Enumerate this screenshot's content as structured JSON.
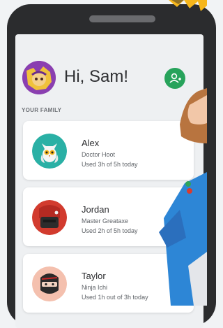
{
  "header": {
    "greeting": "Hi, Sam!"
  },
  "family": {
    "title": "YOUR FAMILY",
    "members": [
      {
        "name": "Alex",
        "device": "Doctor Hoot",
        "usage": "Used 3h of 5h today",
        "avatar_color": "#2ab0a5"
      },
      {
        "name": "Jordan",
        "device": "Master Greataxe",
        "usage": "Used 2h of 5h today",
        "avatar_color": "#d23b2e"
      },
      {
        "name": "Taylor",
        "device": "Ninja Ichi",
        "usage": "Used 1h out of 3h today",
        "avatar_color": "#f2b6a6"
      }
    ]
  },
  "colors": {
    "accent": "#27a35b",
    "phone_body": "#2b2c2e",
    "screen_bg": "#eef0f2",
    "shirt": "#2d86d6",
    "hair": "#b8743f",
    "burst": "#f6b61b"
  },
  "icons": {
    "add_user": "person-add-icon"
  }
}
